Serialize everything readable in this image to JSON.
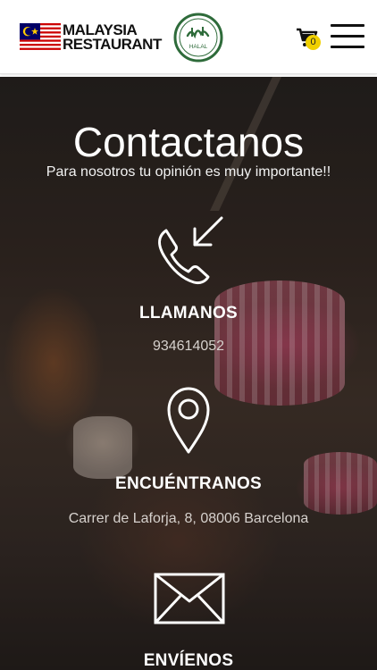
{
  "header": {
    "brand_line1": "MALAYSIA",
    "brand_line2": "RESTAURANT",
    "halal_text": "HALAL",
    "cart_count": "0",
    "colors": {
      "badge": "#f0d000",
      "header_bg": "#ffffff"
    },
    "icons": [
      "malaysia-flag-icon",
      "halal-logo-icon",
      "cart-icon",
      "hamburger-menu-icon"
    ]
  },
  "hero": {
    "title": "Contactanos",
    "subtitle": "Para nosotros tu opinión es muy importante!!"
  },
  "sections": [
    {
      "icon": "phone-incoming-icon",
      "heading": "LLAMANOS",
      "value": "934614052"
    },
    {
      "icon": "map-pin-icon",
      "heading": "ENCUÉNTRANOS",
      "value": "Carrer de Laforja, 8, 08006 Barcelona"
    },
    {
      "icon": "envelope-icon",
      "heading": "ENVÍENOS"
    }
  ]
}
